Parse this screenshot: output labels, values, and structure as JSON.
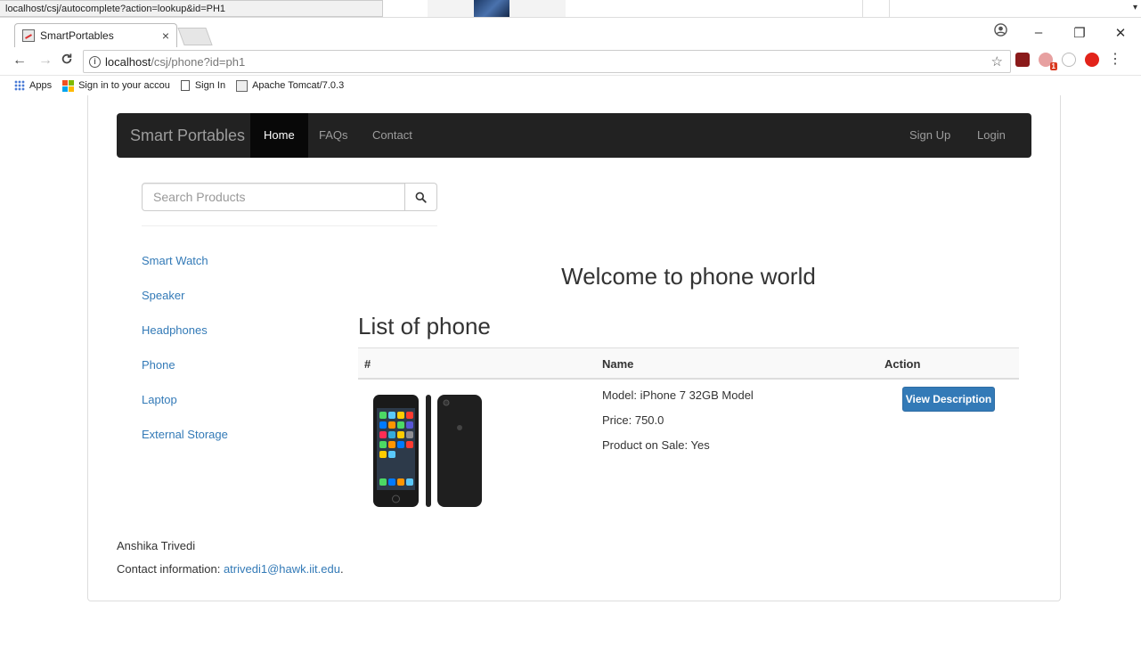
{
  "status": {
    "hover_url": "localhost/csj/autocomplete?action=lookup&id=PH1"
  },
  "browser": {
    "tab_title": "SmartPortables",
    "tab_close": "×",
    "url_host": "localhost",
    "url_path": "/csj/phone?id=ph1",
    "window_controls": [
      "–",
      "❐",
      "✕"
    ],
    "ext_badge": "1",
    "bookmarks": [
      {
        "label": "Apps",
        "icon": "apps-icon"
      },
      {
        "label": "Sign in to your accou",
        "icon": "microsoft-icon"
      },
      {
        "label": "Sign In",
        "icon": "page-icon"
      },
      {
        "label": "Apache Tomcat/7.0.3",
        "icon": "tomcat-icon"
      }
    ]
  },
  "navbar": {
    "brand": "Smart Portables",
    "links": [
      "Home",
      "FAQs",
      "Contact"
    ],
    "right_links": [
      "Sign Up",
      "Login"
    ]
  },
  "search": {
    "placeholder": "Search Products",
    "value": ""
  },
  "sidebar": {
    "items": [
      "Smart Watch",
      "Speaker",
      "Headphones",
      "Phone",
      "Laptop",
      "External Storage"
    ]
  },
  "main": {
    "welcome": "Welcome to phone world",
    "list_title": "List of phone",
    "columns": [
      "#",
      "Name",
      "Action"
    ],
    "products": [
      {
        "model": "Model: iPhone 7 32GB Model",
        "price": "Price: 750.0",
        "on_sale": "Product on Sale: Yes",
        "action": "View Description"
      }
    ]
  },
  "footer": {
    "name": "Anshika Trivedi",
    "contact_label": "Contact information: ",
    "email": "atrivedi1@hawk.iit.edu",
    "email_suffix": "."
  },
  "colors": {
    "link": "#337ab7",
    "navbar_bg": "#222222",
    "button_primary": "#337ab7"
  }
}
